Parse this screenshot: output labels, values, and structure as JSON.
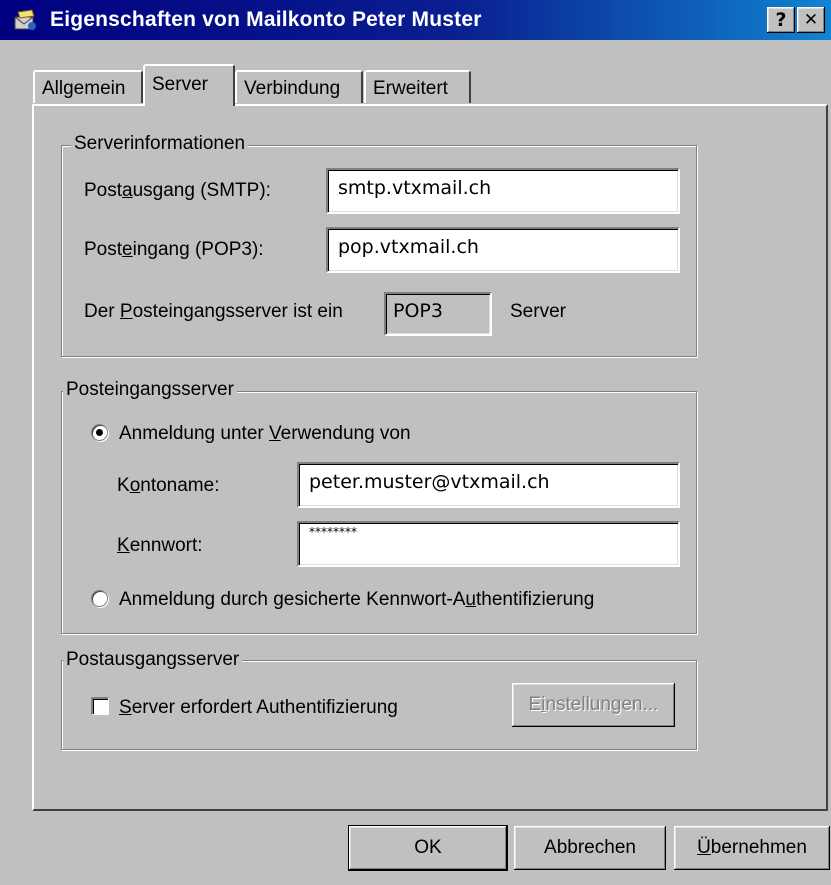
{
  "window": {
    "title": "Eigenschaften von Mailkonto Peter Muster",
    "help_label": "?",
    "close_label": "✕"
  },
  "tabs": [
    {
      "label": "Allgemein",
      "active": false
    },
    {
      "label": "Server",
      "active": true
    },
    {
      "label": "Verbindung",
      "active": false
    },
    {
      "label": "Erweitert",
      "active": false
    }
  ],
  "server_info": {
    "legend": "Serverinformationen",
    "smtp_label_pre": "Post",
    "smtp_label_key": "a",
    "smtp_label_post": "usgang (SMTP):",
    "smtp_value": "smtp.vtxmail.ch",
    "pop3_label_pre": "Post",
    "pop3_label_key": "e",
    "pop3_label_post": "ingang (POP3):",
    "pop3_value": "pop.vtxmail.ch",
    "type_label_pre": "Der ",
    "type_label_key": "P",
    "type_label_post": "osteingangsserver ist ein",
    "type_value": "POP3",
    "type_suffix": "Server"
  },
  "incoming": {
    "legend": "Posteingangsserver",
    "radio_login_pre": "Anmeldung unter ",
    "radio_login_key": "V",
    "radio_login_post": "erwendung von",
    "radio_login_selected": true,
    "account_label_pre": "K",
    "account_label_key": "o",
    "account_label_post": "ntoname:",
    "account_value": "peter.muster@vtxmail.ch",
    "password_label_key": "K",
    "password_label_post": "ennwort:",
    "password_value": "********",
    "radio_spa_pre": "Anmeldung durch gesicherte Kennwort-A",
    "radio_spa_key": "u",
    "radio_spa_post": "thentifizierung",
    "radio_spa_selected": false
  },
  "outgoing": {
    "legend": "Postausgangsserver",
    "auth_key": "S",
    "auth_post": "erver erfordert Authentifizierung",
    "auth_checked": false,
    "settings_pre": "E",
    "settings_key": "i",
    "settings_post": "nstellungen..."
  },
  "buttons": {
    "ok": "OK",
    "cancel": "Abbrechen",
    "apply_key": "Ü",
    "apply_post": "bernehmen"
  },
  "colors": {
    "titlebar_start": "#000080",
    "titlebar_end": "#1084d0",
    "face": "#c0c0c0"
  }
}
